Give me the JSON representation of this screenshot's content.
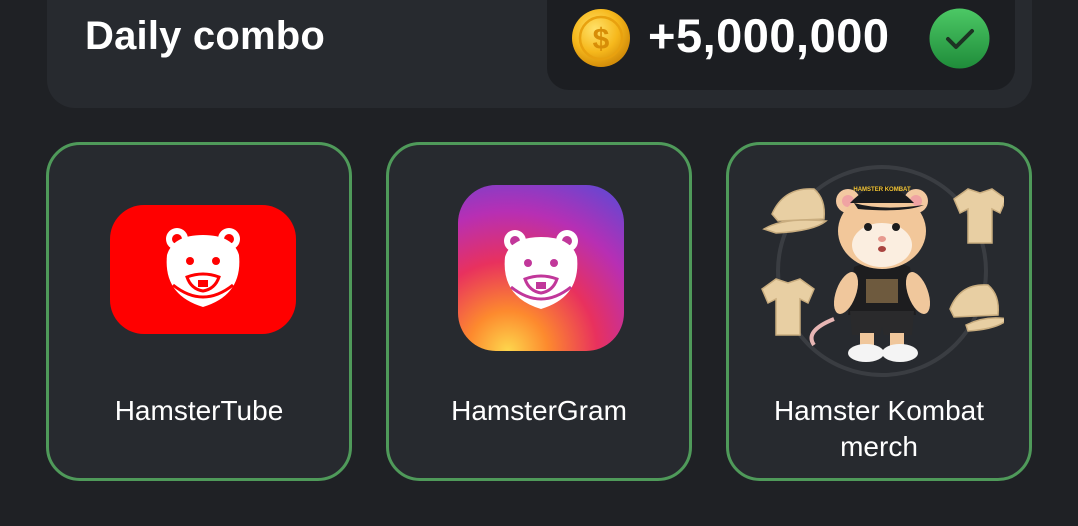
{
  "header": {
    "title": "Daily combo",
    "reward": "+5,000,000",
    "coin_icon": "dollar-coin-icon",
    "status_icon": "check-circle-icon"
  },
  "cards": [
    {
      "label": "HamsterTube",
      "image": "hamstertube-logo",
      "completed": true
    },
    {
      "label": "HamsterGram",
      "image": "hamstergram-logo",
      "completed": true
    },
    {
      "label_line1": "Hamster Kombat",
      "label_line2": "merch",
      "image": "hamster-merch-illustration",
      "cap_text": "HAMSTER KOMBAT",
      "completed": true
    }
  ],
  "colors": {
    "background": "#1f2125",
    "panel": "#272a2f",
    "card_border": "#4f9a5a",
    "check_green": "#2fa84a",
    "coin_gold": "#f2b518",
    "tube_red": "#ff0000"
  }
}
